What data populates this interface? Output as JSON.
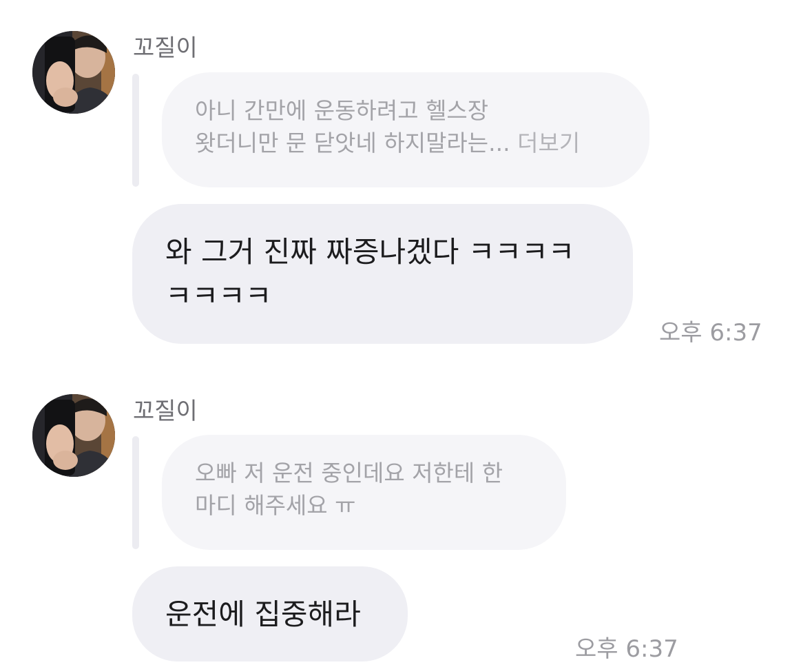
{
  "conversation": {
    "messages": [
      {
        "sender": "꼬질이",
        "avatar_icon": "profile-photo-avatar",
        "quoted_text": "아니 간만에 운동하려고 헬스장\n왓더니만 문 닫앗네 하지말라는...",
        "quoted_more": "더보기",
        "reply_text": "와 그거 진짜 짜증나겠다 ㅋㅋㅋㅋ\nㅋㅋㅋㅋ",
        "time": "오후 6:37"
      },
      {
        "sender": "꼬질이",
        "avatar_icon": "profile-photo-avatar",
        "quoted_text": "오빠 저 운전 중인데요 저한테 한\n마디 해주세요 ㅠ",
        "quoted_more": "",
        "reply_text": "운전에 집중해라",
        "time": "오후 6:37"
      }
    ]
  },
  "colors": {
    "quote_bubble_bg": "#f5f5f8",
    "reply_bubble_bg": "#efeff4",
    "quote_bar": "#ececf1",
    "sender_text": "#6e6e73",
    "time_text": "#9c9ca1"
  }
}
